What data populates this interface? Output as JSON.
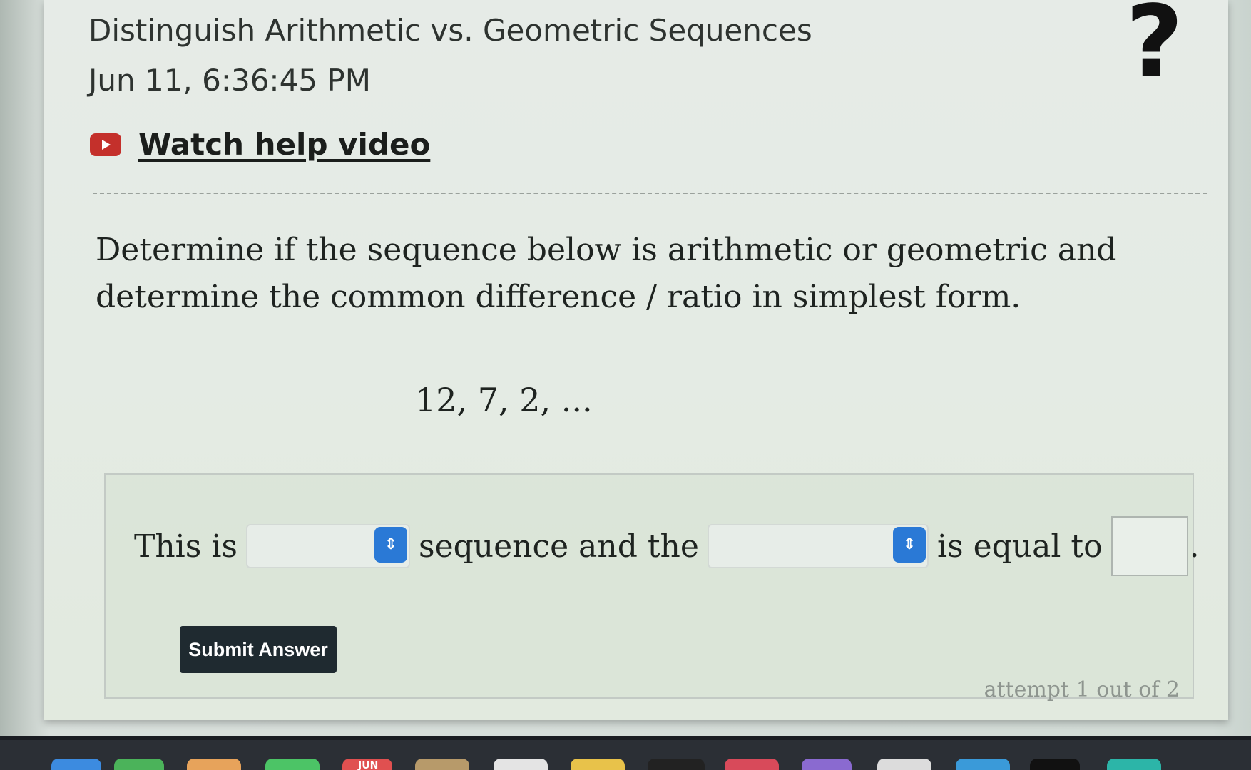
{
  "header": {
    "title": "Distinguish Arithmetic vs. Geometric Sequences",
    "timestamp": "Jun 11, 6:36:45 PM",
    "help_icon": "question-mark-icon",
    "help_glyph": "?"
  },
  "help_video": {
    "icon": "youtube-play-icon",
    "label": "Watch help video"
  },
  "question": {
    "prompt": "Determine if the sequence below is arithmetic or geometric and determine the common difference / ratio in simplest form.",
    "sequence": "12, 7, 2, ..."
  },
  "answer": {
    "prefix": "This is",
    "select_type": {
      "value": "",
      "icon": "chevron-up-down-icon"
    },
    "middle": "sequence and the",
    "select_quantity": {
      "value": "",
      "icon": "chevron-up-down-icon"
    },
    "suffix": "is equal to",
    "input_value": "",
    "period": "."
  },
  "submit": {
    "label": "Submit Answer"
  },
  "attempt": {
    "text": "attempt 1 out of 2"
  },
  "dock": {
    "calendar_month": "JUN"
  }
}
